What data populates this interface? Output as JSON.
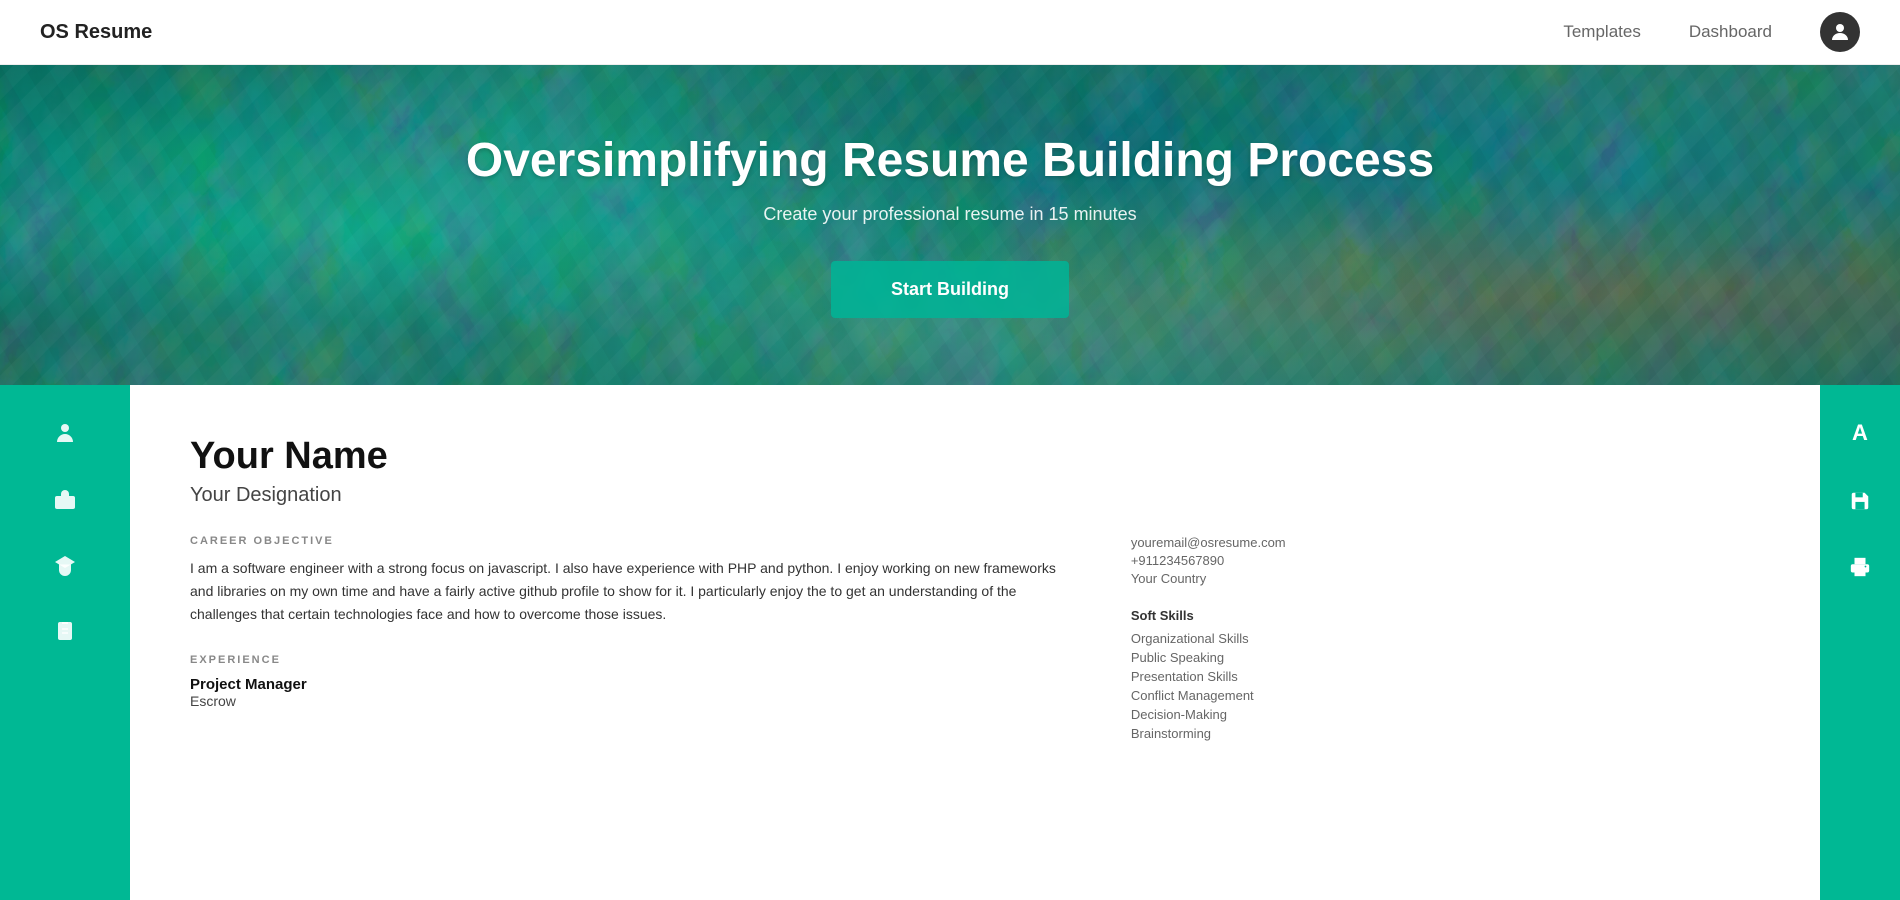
{
  "navbar": {
    "brand": "OS Resume",
    "links": [
      "Templates",
      "Dashboard"
    ],
    "avatar_initial": "👤"
  },
  "hero": {
    "title": "Oversimplifying Resume Building Process",
    "subtitle": "Create your professional resume in 15 minutes",
    "cta_label": "Start Building"
  },
  "left_sidebar": {
    "icons": [
      "person",
      "briefcase",
      "graduation",
      "clipboard"
    ]
  },
  "right_sidebar": {
    "icons": [
      {
        "symbol": "A",
        "label": "Font"
      },
      {
        "symbol": "💾",
        "label": "Save"
      },
      {
        "symbol": "🖨",
        "label": "Print"
      }
    ]
  },
  "resume": {
    "name": "Your Name",
    "designation": "Your Designation",
    "career_objective_label": "CAREER OBJECTIVE",
    "career_objective_text": "I am a software engineer with a strong focus on javascript. I also have experience with PHP and python. I enjoy working on new frameworks and libraries on my own time and have a fairly active github profile to show for it. I particularly enjoy the to get an understanding of the challenges that certain technologies face and how to overcome those issues.",
    "experience_label": "EXPERIENCE",
    "job_title": "Project Manager",
    "job_company": "Escrow",
    "contact": {
      "email": "youremail@osresume.com",
      "phone": "+911234567890",
      "country": "Your Country"
    },
    "soft_skills_label": "Soft Skills",
    "soft_skills": [
      "Organizational Skills",
      "Public Speaking",
      "Presentation Skills",
      "Conflict Management",
      "Decision-Making",
      "Brainstorming"
    ]
  }
}
